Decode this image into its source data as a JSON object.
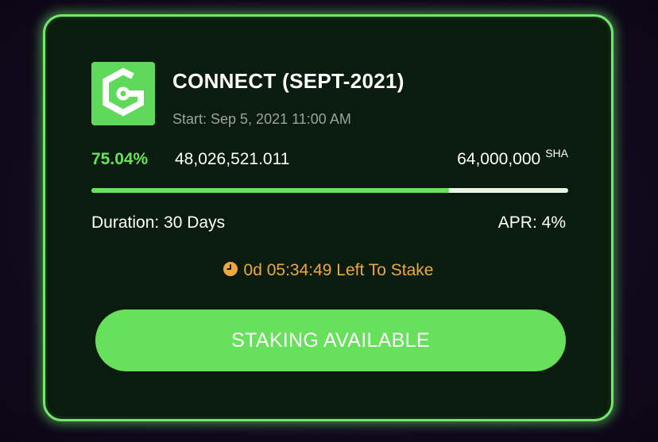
{
  "pool": {
    "title": "CONNECT (SEPT-2021)",
    "start": "Start: Sep 5, 2021 11:00 AM",
    "logo_icon": "connect-logo-icon",
    "percent_label": "75.04%",
    "staked_amount": "48,026,521.011",
    "total_amount": "64,000,000",
    "unit": "SHA",
    "progress_fraction": 0.7504,
    "duration": "Duration: 30 Days",
    "apr": "APR: 4%",
    "timer_icon": "clock-icon",
    "time_left": "0d 05:34:49 Left To Stake",
    "button_label": "STAKING AVAILABLE"
  },
  "colors": {
    "accent_green": "#67e05c",
    "card_background": "#0a1c0d",
    "timer_orange": "#f0a83a",
    "progress_track": "#e8f6e6"
  }
}
